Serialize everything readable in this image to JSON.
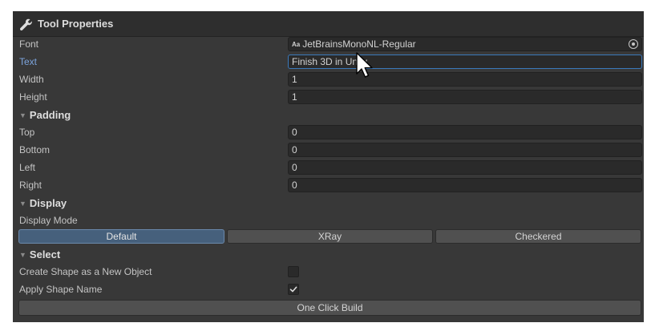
{
  "window": {
    "title": "Tool Properties",
    "icon": "wrench-icon"
  },
  "font": {
    "label": "Font",
    "value": "JetBrainsMonoNL-Regular",
    "icon_text": "Aa"
  },
  "text": {
    "label": "Text",
    "value": "Finish 3D in Unity"
  },
  "width": {
    "label": "Width",
    "value": "1"
  },
  "height": {
    "label": "Height",
    "value": "1"
  },
  "padding": {
    "header": "Padding",
    "top": {
      "label": "Top",
      "value": "0"
    },
    "bottom": {
      "label": "Bottom",
      "value": "0"
    },
    "left": {
      "label": "Left",
      "value": "0"
    },
    "right": {
      "label": "Right",
      "value": "0"
    }
  },
  "display": {
    "header": "Display",
    "mode_label": "Display Mode",
    "options": [
      "Default",
      "XRay",
      "Checkered"
    ],
    "selected": "Default"
  },
  "select": {
    "header": "Select",
    "create_new_object": {
      "label": "Create Shape as a New Object",
      "checked": false
    },
    "apply_shape_name": {
      "label": "Apply Shape Name",
      "checked": true
    }
  },
  "actions": {
    "build_label": "One Click Build"
  },
  "colors": {
    "panel_bg": "#383838",
    "field_bg": "#2a2a2a",
    "accent_blue": "#3a79bb",
    "selected_seg": "#46607c"
  }
}
